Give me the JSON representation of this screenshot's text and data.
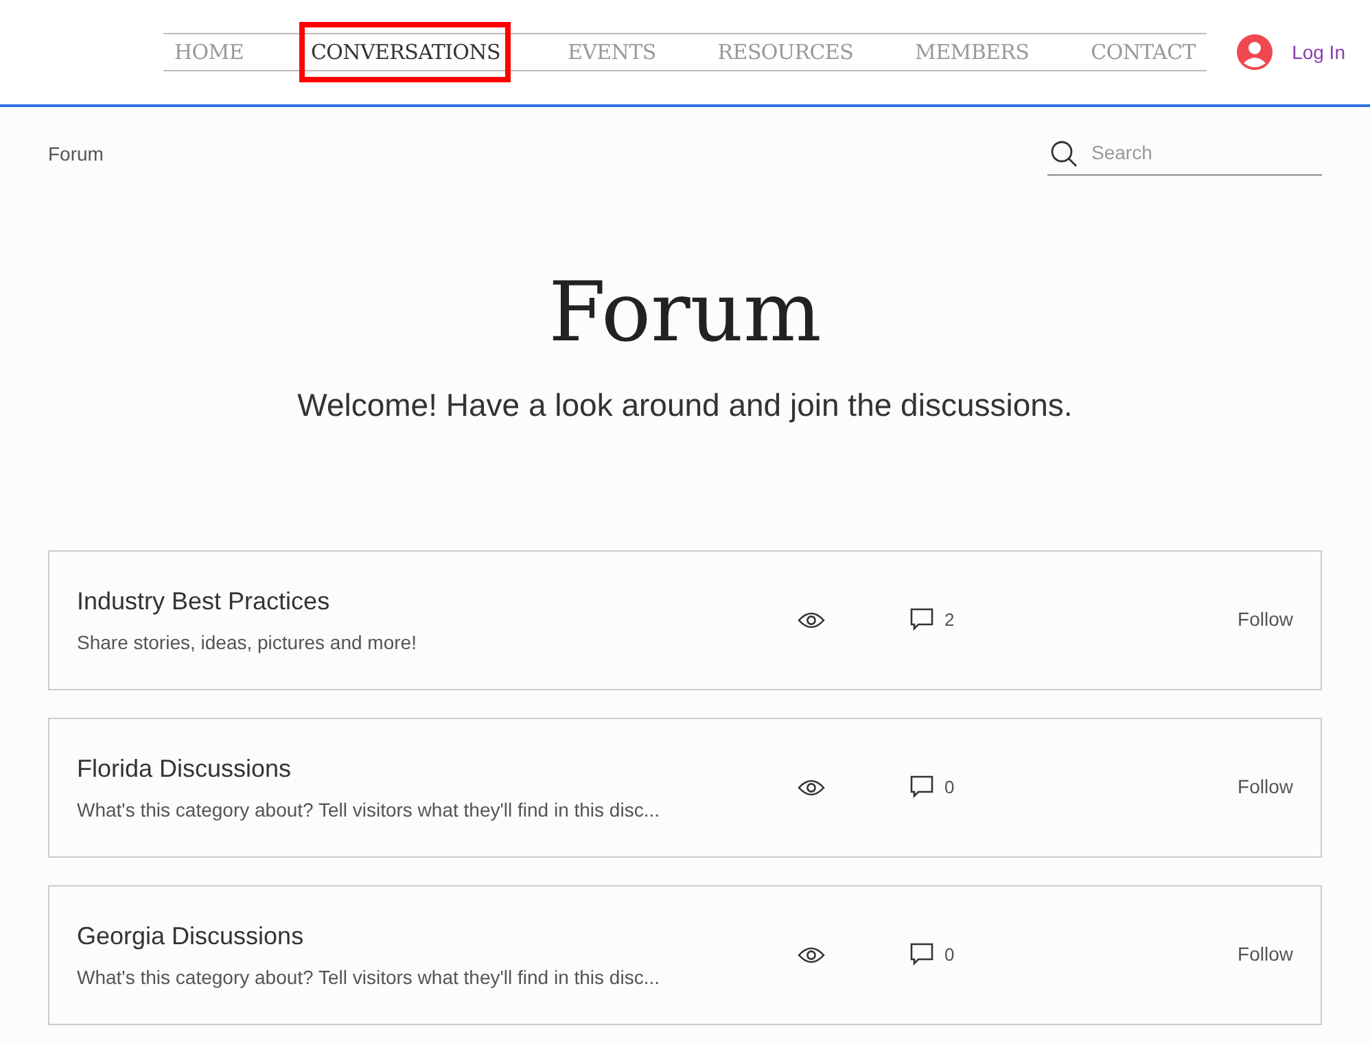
{
  "nav": {
    "items": [
      {
        "label": "HOME",
        "selected": false
      },
      {
        "label": "CONVERSATIONS",
        "selected": true
      },
      {
        "label": "EVENTS",
        "selected": false
      },
      {
        "label": "RESOURCES",
        "selected": false
      },
      {
        "label": "MEMBERS",
        "selected": false
      },
      {
        "label": "CONTACT",
        "selected": false
      }
    ],
    "login": "Log In"
  },
  "breadcrumb": "Forum",
  "search": {
    "placeholder": "Search"
  },
  "hero": {
    "title": "Forum",
    "subtitle": "Welcome! Have a look around and join the discussions."
  },
  "categories": [
    {
      "title": "Industry Best Practices",
      "description": "Share stories, ideas, pictures and more!",
      "comments": "2",
      "action": "Follow"
    },
    {
      "title": "Florida Discussions",
      "description": "What's this category about? Tell visitors what they'll find in this disc...",
      "comments": "0",
      "action": "Follow"
    },
    {
      "title": "Georgia Discussions",
      "description": "What's this category about? Tell visitors what they'll find in this disc...",
      "comments": "0",
      "action": "Follow"
    }
  ]
}
